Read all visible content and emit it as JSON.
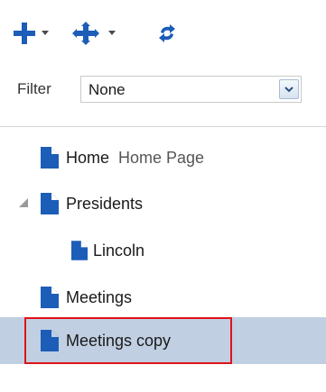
{
  "toolbar": {
    "add_icon": "add-icon",
    "move_icon": "move-icon",
    "refresh_icon": "refresh-icon",
    "icon_color": "#1c5db7"
  },
  "filter": {
    "label": "Filter",
    "selected": "None"
  },
  "tree": {
    "nodes": [
      {
        "label": "Home",
        "description": "Home Page"
      },
      {
        "label": "Presidents",
        "expanded": true
      },
      {
        "label": "Lincoln",
        "parent": "Presidents"
      },
      {
        "label": "Meetings"
      },
      {
        "label": "Meetings copy",
        "selected": true
      }
    ],
    "selection_color": "#c0cfe2",
    "highlight_color": "#e0131a"
  }
}
